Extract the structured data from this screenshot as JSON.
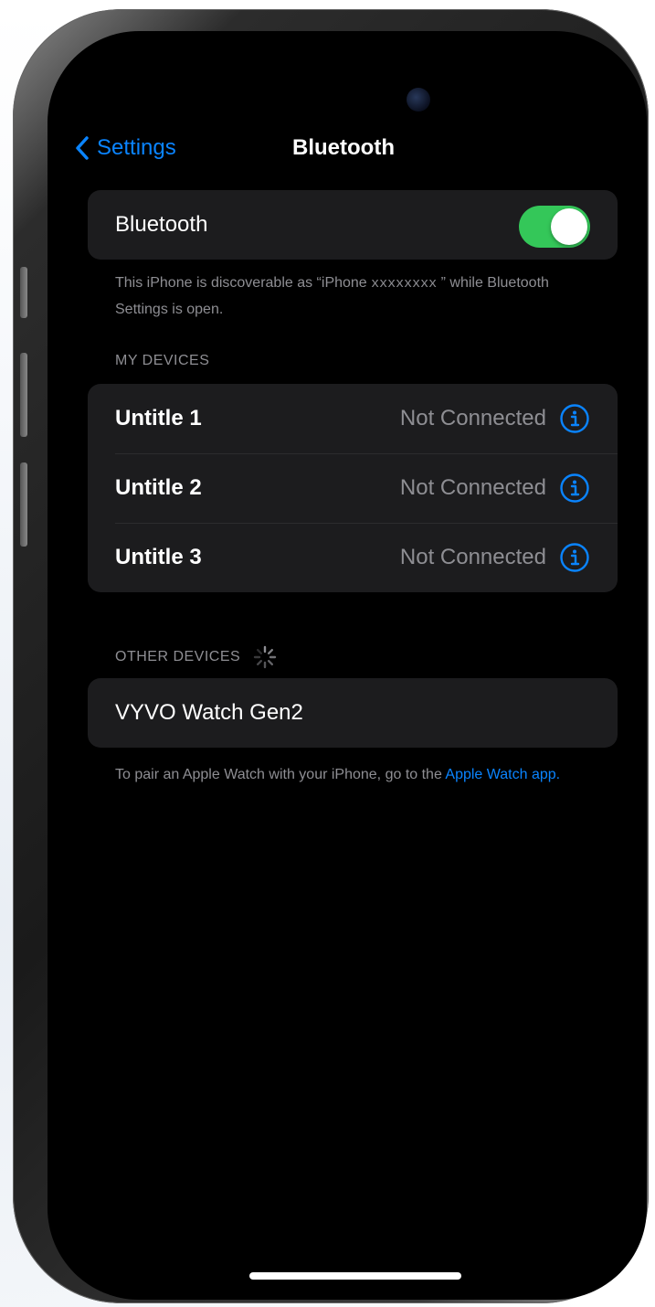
{
  "colors": {
    "accent": "#0a84ff",
    "toggle_on": "#34c759",
    "group_bg": "#1c1c1e",
    "secondary_text": "#8e8e93"
  },
  "navbar": {
    "back_label": "Settings",
    "title": "Bluetooth"
  },
  "bluetooth": {
    "label": "Bluetooth",
    "enabled": true
  },
  "discoverable": {
    "prefix": "This iPhone is discoverable as “iPhone ",
    "device_name": "xxxxxxxx",
    "suffix": " ” while Bluetooth Settings is open."
  },
  "my_devices": {
    "header": "MY DEVICES",
    "items": [
      {
        "name": "Untitle 1",
        "status": "Not Connected"
      },
      {
        "name": "Untitle 2",
        "status": "Not Connected"
      },
      {
        "name": "Untitle 3",
        "status": "Not Connected"
      }
    ]
  },
  "other_devices": {
    "header": "OTHER DEVICES",
    "items": [
      {
        "name": "VYVO Watch Gen2"
      }
    ]
  },
  "apple_watch_note": {
    "text": "To pair an Apple Watch with your iPhone, go to the ",
    "link": "Apple Watch app."
  },
  "icons": {
    "back": "chevron-left-icon",
    "info": "info-circle-icon",
    "spinner": "activity-spinner-icon",
    "camera": "front-camera-icon"
  }
}
